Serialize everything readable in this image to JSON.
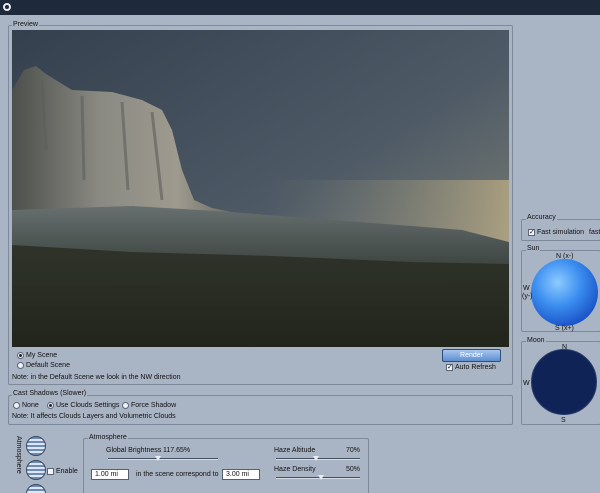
{
  "preview": {
    "group_title": "Preview",
    "scene_options": [
      {
        "label": "My Scene",
        "selected": true
      },
      {
        "label": "Default Scene",
        "selected": false
      }
    ],
    "note": "Note: in the Default Scene we look in the NW direction",
    "render_label": "Render",
    "auto_refresh_label": "Auto Refresh",
    "auto_refresh_checked": true
  },
  "shadows": {
    "group_title": "Cast Shadows (Slower)",
    "options": [
      {
        "label": "None",
        "selected": false
      },
      {
        "label": "Use Clouds Settings",
        "selected": true
      },
      {
        "label": "Force Shadow",
        "selected": false
      }
    ],
    "note": "Note: It affects Clouds Layers and Volumetric Clouds"
  },
  "accuracy": {
    "group_title": "Accuracy",
    "fast_simulation_label": "Fast simulation",
    "fast_simulation_checked": true,
    "trailing_text": "fast"
  },
  "sun": {
    "group_title": "Sun",
    "n": "N (x-)",
    "w1": "W",
    "w2": "(y-)",
    "s": "S (x+)",
    "color_light": "#8ecbff",
    "color_dark": "#1b55c8"
  },
  "moon": {
    "group_title": "Moon",
    "n": "N",
    "w": "W",
    "s": "S",
    "color": "#0f2356"
  },
  "atmosphere": {
    "side_label": "Atmosphere",
    "enable_label": "Enable",
    "enable_checked": false,
    "group_title": "Atmosphere",
    "global_brightness_label": "Global Brightness",
    "global_brightness_value": "117.65%",
    "global_brightness_fraction": 0.45,
    "haze_altitude_label": "Haze Altitude",
    "haze_altitude_value": "70%",
    "haze_altitude_fraction": 0.48,
    "haze_density_label": "Haze Density",
    "haze_density_value": "50%",
    "haze_density_fraction": 0.53,
    "scale_from": "1.00 mi",
    "scale_text": "in the scene correspond to",
    "scale_to": "3.00 mi"
  }
}
